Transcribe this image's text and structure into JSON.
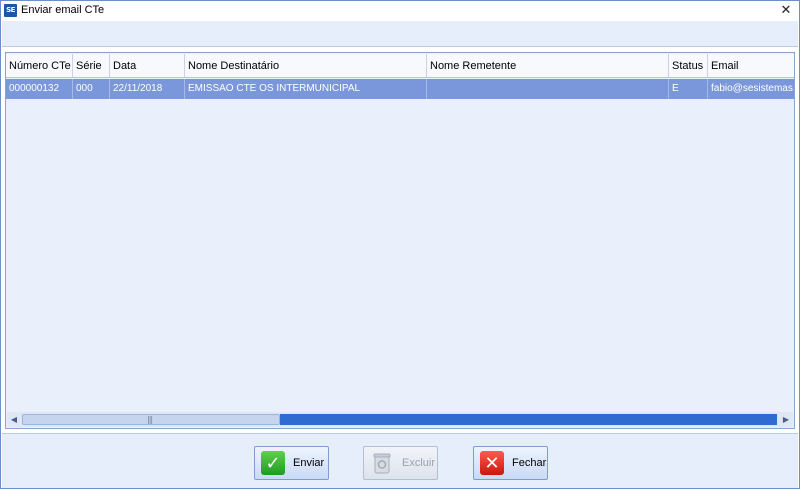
{
  "window": {
    "app_icon_text": "SE",
    "title": "Enviar email CTe",
    "close_glyph": "✕"
  },
  "grid": {
    "columns": [
      "Número CTe",
      "Série",
      "Data",
      "Nome Destinatário",
      "Nome Remetente",
      "Status",
      "Email"
    ],
    "rows": [
      {
        "numero": "000000132",
        "serie": "000",
        "data": "22/11/2018",
        "destinatario": "EMISSAO CTE OS INTERMUNICIPAL",
        "remetente": "",
        "status": "E",
        "email": "fabio@sesistemas."
      }
    ],
    "selected_row_color": "#7b97db"
  },
  "scrollbar": {
    "left_arrow": "◀",
    "right_arrow": "▶",
    "grip": "|||"
  },
  "footer": {
    "enviar": {
      "label": "Enviar",
      "icon": "check-icon",
      "glyph": "✓"
    },
    "excluir": {
      "label": "Excluir",
      "icon": "trash-icon",
      "glyph": "🗑",
      "disabled": true
    },
    "fechar": {
      "label": "Fechar",
      "icon": "close-x-icon",
      "glyph": "✕"
    }
  }
}
